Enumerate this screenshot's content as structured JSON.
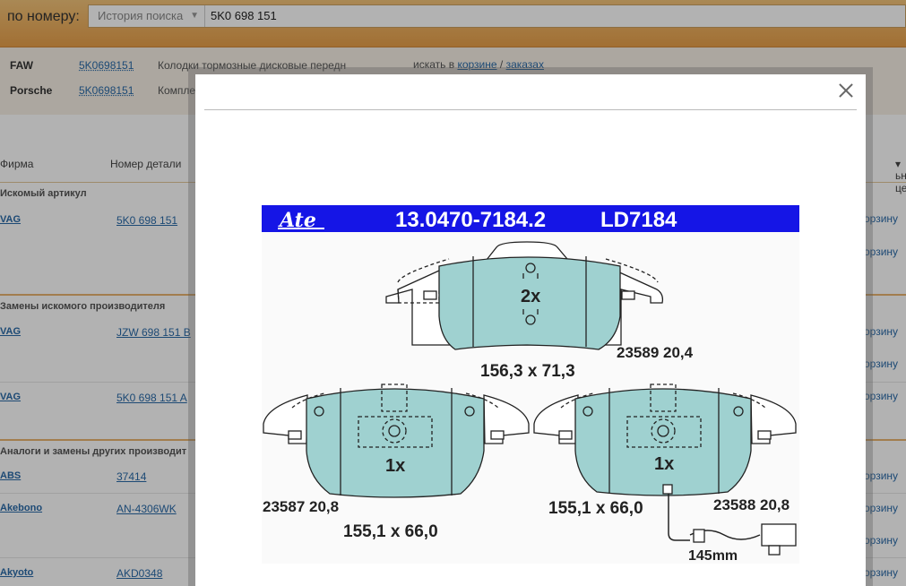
{
  "header": {
    "search_label": "по номеру:",
    "history_label": "История поиска",
    "query": "5K0 698 151"
  },
  "brands": [
    {
      "firm": "FAW",
      "number": "5K0698151",
      "description": "Колодки тормозные дисковые передн"
    },
    {
      "firm": "Porsche",
      "number": "5K0698151",
      "description": "Компле"
    }
  ],
  "basket_note": {
    "prefix": "искать в",
    "link1": "корзине",
    "sep": "/",
    "link2": "заказах"
  },
  "table": {
    "col_firm": "Фирма",
    "col_number": "Номер детали",
    "price_sort": "ьн цен",
    "sections": [
      {
        "title": "Искомый артикул"
      },
      {
        "title": "Замены искомого производителя"
      },
      {
        "title": "Аналоги и замены других производит"
      }
    ],
    "rows": [
      {
        "firm": "VAG",
        "number": "5K0 698 151"
      },
      {
        "firm": "VAG",
        "number": "JZW 698 151 B"
      },
      {
        "firm": "VAG",
        "number": "5K0 698 151 A"
      },
      {
        "firm": "ABS",
        "number": "37414"
      },
      {
        "firm": "Akebono",
        "number": "AN-4306WK"
      },
      {
        "firm": "Akyoto",
        "number": "AKD0348"
      }
    ],
    "cart_label": "орзину"
  },
  "modal": {
    "brand_logo": "Ate",
    "part_number": "13.0470-7184.2",
    "ld_code": "LD7184",
    "top_pad": {
      "qty": "2x",
      "code": "23589 20,4",
      "dims": "156,3 x 71,3"
    },
    "left_pad": {
      "qty": "1x",
      "code": "23587 20,8",
      "dims": "155,1 x 66,0"
    },
    "right_pad": {
      "qty": "1x",
      "code": "23588 20,8",
      "dims": "155,1 x 66,0",
      "wire": "145mm"
    },
    "colors": {
      "band": "#1515e6",
      "pad_fill": "#9fd1d0",
      "line": "#222222"
    }
  }
}
